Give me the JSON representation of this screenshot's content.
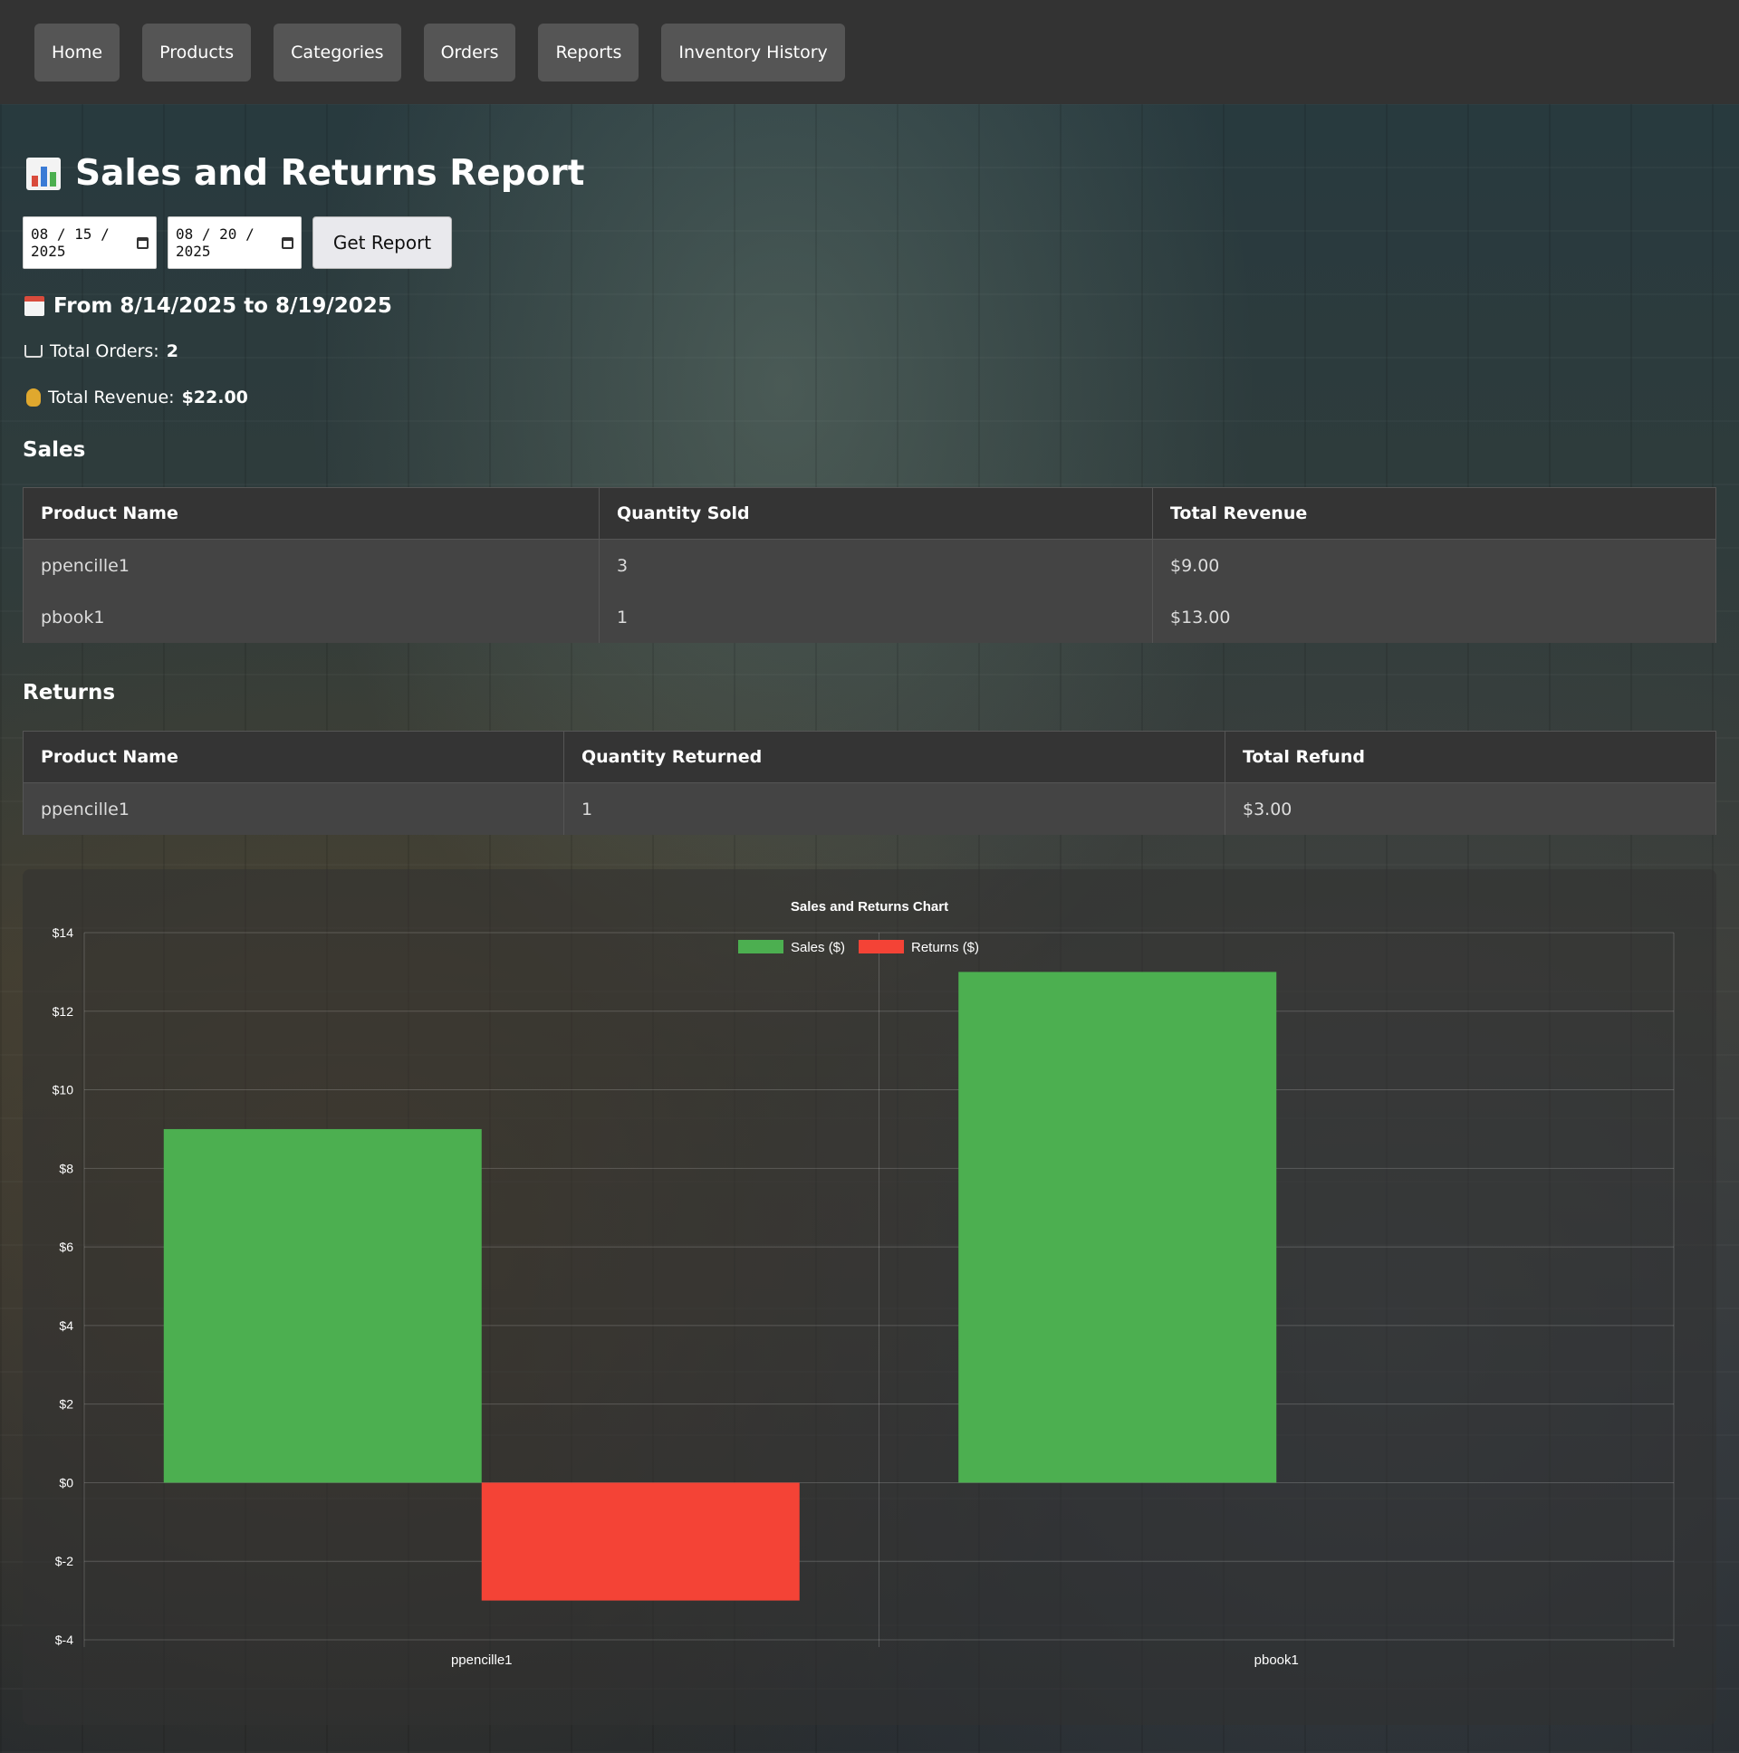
{
  "nav": {
    "items": [
      "Home",
      "Products",
      "Categories",
      "Orders",
      "Reports",
      "Inventory History"
    ]
  },
  "page": {
    "title": "Sales and Returns Report",
    "start_date": "08 / 15 / 2025",
    "end_date": "08 / 20 / 2025",
    "get_report_label": "Get Report",
    "range_text": "From 8/14/2025 to 8/19/2025",
    "total_orders_label": "Total Orders:",
    "total_orders_value": "2",
    "total_revenue_label": "Total Revenue:",
    "total_revenue_value": "$22.00"
  },
  "sales": {
    "title": "Sales",
    "headers": [
      "Product Name",
      "Quantity Sold",
      "Total Revenue"
    ],
    "rows": [
      [
        "ppencille1",
        "3",
        "$9.00"
      ],
      [
        "pbook1",
        "1",
        "$13.00"
      ]
    ]
  },
  "returns": {
    "title": "Returns",
    "headers": [
      "Product Name",
      "Quantity Returned",
      "Total Refund"
    ],
    "rows": [
      [
        "ppencille1",
        "1",
        "$3.00"
      ]
    ]
  },
  "chart_data": {
    "type": "bar",
    "title": "Sales and Returns Chart",
    "categories": [
      "ppencille1",
      "pbook1"
    ],
    "series": [
      {
        "name": "Sales ($)",
        "values": [
          9,
          13
        ],
        "color": "#4caf50"
      },
      {
        "name": "Returns ($)",
        "values": [
          -3,
          0
        ],
        "color": "#f44336"
      }
    ],
    "ylim": [
      -4,
      14
    ],
    "yticks": [
      14,
      12,
      10,
      8,
      6,
      4,
      2,
      0,
      -2,
      -4
    ],
    "ytick_labels": [
      "$14",
      "$12",
      "$10",
      "$8",
      "$6",
      "$4",
      "$2",
      "$0",
      "$-2",
      "$-4"
    ],
    "legend": "top",
    "grid": true
  },
  "icons": {
    "report": "bar-chart-icon",
    "calendar": "calendar-icon",
    "orders": "shopping-cart-icon",
    "revenue": "money-bag-icon"
  }
}
